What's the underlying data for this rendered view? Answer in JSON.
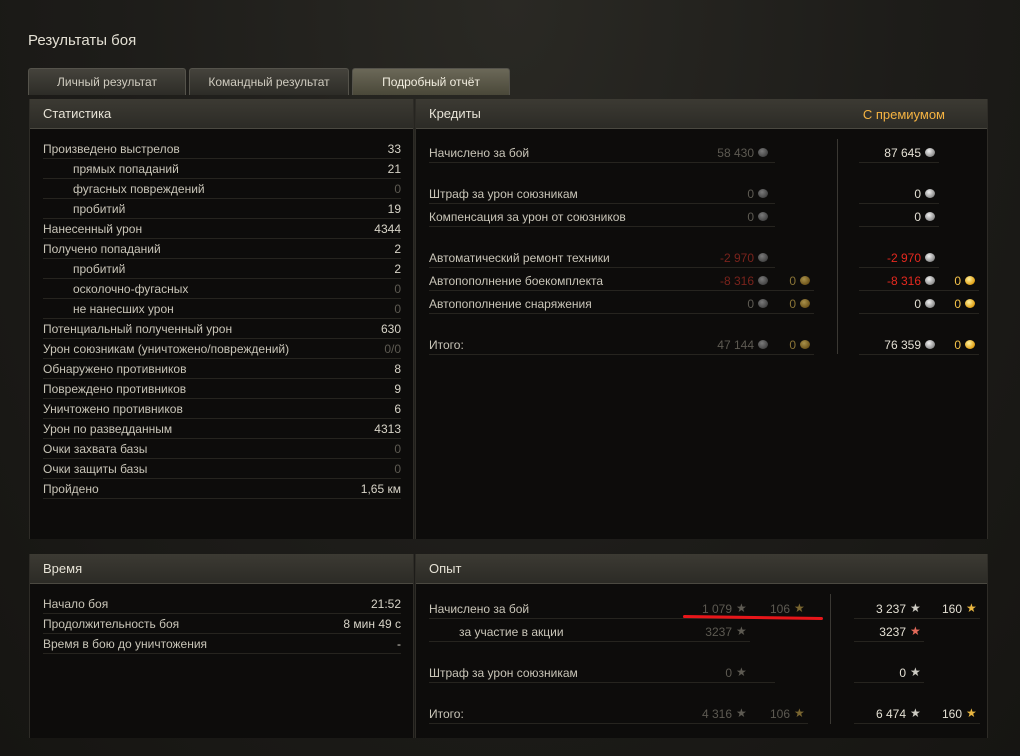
{
  "window": {
    "title": "Результаты боя"
  },
  "tabs": {
    "personal": "Личный результат",
    "team": "Командный результат",
    "detailed": "Подробный отчёт"
  },
  "stats": {
    "header": "Статистика",
    "rows": [
      {
        "label": "Произведено выстрелов",
        "value": "33"
      },
      {
        "label": "прямых попаданий",
        "value": "21"
      },
      {
        "label": "фугасных повреждений",
        "value": "0"
      },
      {
        "label": "пробитий",
        "value": "19"
      },
      {
        "label": "Нанесенный урон",
        "value": "4344"
      },
      {
        "label": "Получено попаданий",
        "value": "2"
      },
      {
        "label": "пробитий",
        "value": "2"
      },
      {
        "label": "осколочно-фугасных",
        "value": "0"
      },
      {
        "label": "не нанесших урон",
        "value": "0"
      },
      {
        "label": "Потенциальный полученный урон",
        "value": "630"
      },
      {
        "label": "Урон союзникам (уничтожено/повреждений)",
        "value": "0/0"
      },
      {
        "label": "Обнаружено противников",
        "value": "8"
      },
      {
        "label": "Повреждено противников",
        "value": "9"
      },
      {
        "label": "Уничтожено противников",
        "value": "6"
      },
      {
        "label": "Урон по разведданным",
        "value": "4313"
      },
      {
        "label": "Очки захвата базы",
        "value": "0"
      },
      {
        "label": "Очки защиты базы",
        "value": "0"
      },
      {
        "label": "Пройдено",
        "value": "1,65 км"
      }
    ]
  },
  "credits": {
    "header": "Кредиты",
    "premium_header": "С премиумом",
    "rows": {
      "earned": {
        "label": "Начислено за бой",
        "base": "58 430",
        "premium": "87 645"
      },
      "ally_penalty": {
        "label": "Штраф за урон союзникам",
        "base": "0",
        "premium": "0"
      },
      "ally_comp": {
        "label": "Компенсация за урон от союзников",
        "base": "0",
        "premium": "0"
      },
      "repair": {
        "label": "Автоматический ремонт техники",
        "base": "-2 970",
        "premium": "-2 970"
      },
      "ammo": {
        "label": "Автопополнение боекомплекта",
        "base": "-8 316",
        "base_gold": "0",
        "premium": "-8 316",
        "premium_gold": "0"
      },
      "equipment": {
        "label": "Автопополнение снаряжения",
        "base": "0",
        "base_gold": "0",
        "premium": "0",
        "premium_gold": "0"
      },
      "total": {
        "label": "Итого:",
        "base": "47 144",
        "base_gold": "0",
        "premium": "76 359",
        "premium_gold": "0"
      }
    }
  },
  "time": {
    "header": "Время",
    "rows": [
      {
        "label": "Начало боя",
        "value": "21:52"
      },
      {
        "label": "Продолжительность боя",
        "value": "8 мин 49 с"
      },
      {
        "label": "Время в бою до уничтожения",
        "value": "-"
      }
    ]
  },
  "experience": {
    "header": "Опыт",
    "rows": {
      "earned": {
        "label": "Начислено за бой",
        "base": "1 079",
        "base_free": "106",
        "premium": "3 237",
        "premium_free": "160"
      },
      "action": {
        "label": "за участие в акции",
        "base": "3237",
        "premium": "3237"
      },
      "ally_penalty": {
        "label": "Штраф за урон союзникам",
        "base": "0",
        "premium": "0"
      },
      "total": {
        "label": "Итого:",
        "base": "4 316",
        "base_free": "106",
        "premium": "6 474",
        "premium_free": "160"
      }
    }
  },
  "icons": {
    "credits": "silver-coin-icon",
    "gold": "gold-coin-icon",
    "xp": "star-icon",
    "free_xp": "gold-star-icon"
  },
  "colors": {
    "premium": "#f5b342",
    "negative": "#e5291f",
    "annotation": "#e8161a"
  }
}
